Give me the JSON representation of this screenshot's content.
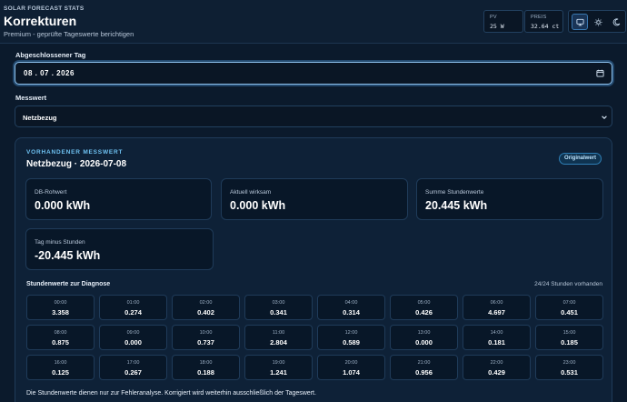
{
  "header": {
    "brand": "SOLAR FORECAST STATS",
    "title": "Korrekturen",
    "subtitle": "Premium - geprüfte Tageswerte berichtigen",
    "pv": {
      "label": "PV",
      "value": "25 W"
    },
    "price": {
      "label": "PREIS",
      "value": "32.64 ct"
    },
    "theme_icons": [
      "monitor-icon",
      "sun-icon",
      "moon-icon"
    ]
  },
  "form": {
    "date_label": "Abgeschlossener Tag",
    "date_value": "08 . 07 . 2026",
    "measure_label": "Messwert",
    "measure_value": "Netzbezug"
  },
  "panel": {
    "kicker": "VORHANDENER MESSWERT",
    "title": "Netzbezug · 2026-07-08",
    "badge": "Originalwert",
    "metrics": [
      {
        "label": "DB-Rohwert",
        "value": "0.000 kWh"
      },
      {
        "label": "Aktuell wirksam",
        "value": "0.000 kWh"
      },
      {
        "label": "Summe Stundenwerte",
        "value": "20.445 kWh"
      },
      {
        "label": "Tag minus Stunden",
        "value": "-20.445 kWh"
      }
    ],
    "hours_title": "Stundenwerte zur Diagnose",
    "hours_count": "24/24 Stunden vorhanden",
    "hours": [
      {
        "time": "00:00",
        "value": "3.358"
      },
      {
        "time": "01:00",
        "value": "0.274"
      },
      {
        "time": "02:00",
        "value": "0.402"
      },
      {
        "time": "03:00",
        "value": "0.341"
      },
      {
        "time": "04:00",
        "value": "0.314"
      },
      {
        "time": "05:00",
        "value": "0.426"
      },
      {
        "time": "06:00",
        "value": "4.697"
      },
      {
        "time": "07:00",
        "value": "0.451"
      },
      {
        "time": "08:00",
        "value": "0.875"
      },
      {
        "time": "09:00",
        "value": "0.000"
      },
      {
        "time": "10:00",
        "value": "0.737"
      },
      {
        "time": "11:00",
        "value": "2.804"
      },
      {
        "time": "12:00",
        "value": "0.589"
      },
      {
        "time": "13:00",
        "value": "0.000"
      },
      {
        "time": "14:00",
        "value": "0.181"
      },
      {
        "time": "15:00",
        "value": "0.185"
      },
      {
        "time": "16:00",
        "value": "0.125"
      },
      {
        "time": "17:00",
        "value": "0.267"
      },
      {
        "time": "18:00",
        "value": "0.188"
      },
      {
        "time": "19:00",
        "value": "1.241"
      },
      {
        "time": "20:00",
        "value": "1.074"
      },
      {
        "time": "21:00",
        "value": "0.956"
      },
      {
        "time": "22:00",
        "value": "0.429"
      },
      {
        "time": "23:00",
        "value": "0.531"
      }
    ],
    "footnote": "Die Stundenwerte dienen nur zur Fehleranalyse. Korrigiert wird weiterhin ausschließlich der Tageswert."
  },
  "colors": {
    "background": "#0b1a2c",
    "accent": "#6ec1f1",
    "focus_ring": "#8fc3ef"
  }
}
